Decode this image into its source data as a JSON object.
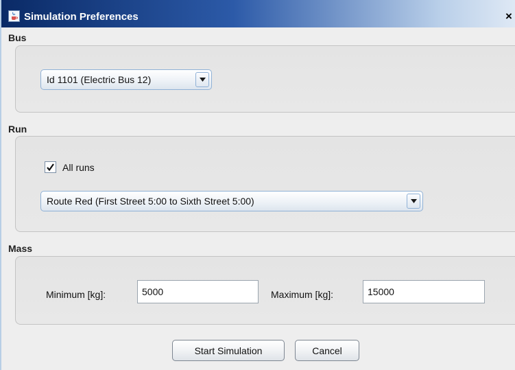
{
  "window": {
    "title": "Simulation Preferences",
    "close_glyph": "×",
    "icon": "java-cup-icon"
  },
  "bus": {
    "section_label": "Bus",
    "selected": "Id 1101 (Electric Bus 12)"
  },
  "run": {
    "section_label": "Run",
    "all_runs_label": "All runs",
    "all_runs_checked": true,
    "selected_route": "Route Red (First Street 5:00 to Sixth Street 5:00)"
  },
  "mass": {
    "section_label": "Mass",
    "min_label": "Minimum [kg]:",
    "min_value": "5000",
    "max_label": "Maximum [kg]:",
    "max_value": "15000"
  },
  "buttons": {
    "start": "Start Simulation",
    "cancel": "Cancel"
  },
  "colors": {
    "title_gradient_start": "#0a2a66",
    "title_gradient_end": "#dfe9f5",
    "panel_bg": "#e6e6e6",
    "combo_border": "#8fb1d6"
  }
}
